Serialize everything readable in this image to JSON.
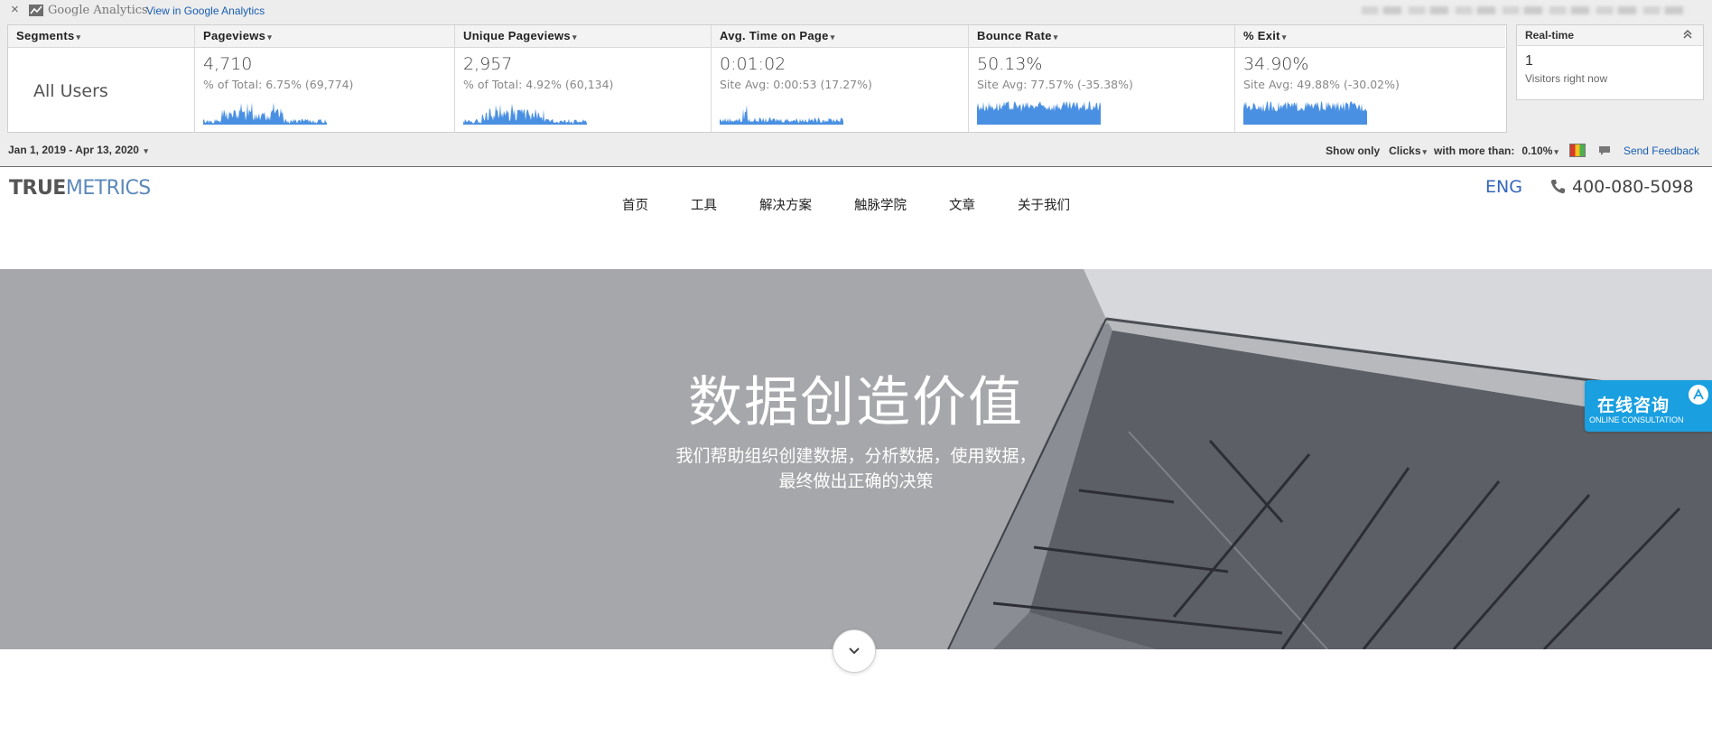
{
  "ga_bar": {
    "close_glyph": "×",
    "logo_text": "Google Analytics",
    "view_link": "View in Google Analytics"
  },
  "metrics": {
    "segments": {
      "header": "Segments",
      "value": "All Users"
    },
    "columns": [
      {
        "header": "Pageviews",
        "value": "4,710",
        "sub": "% of Total: 6.75% (69,774)",
        "spark": "spiky"
      },
      {
        "header": "Unique Pageviews",
        "value": "2,957",
        "sub": "% of Total: 4.92% (60,134)",
        "spark": "spiky"
      },
      {
        "header": "Avg. Time on Page",
        "value": "0:01:02",
        "sub": "Site Avg: 0:00:53 (17.27%)",
        "spark": "spiky-low"
      },
      {
        "header": "Bounce Rate",
        "value": "50.13%",
        "sub": "Site Avg: 77.57% (-35.38%)",
        "spark": "dense"
      },
      {
        "header": "% Exit",
        "value": "34.90%",
        "sub": "Site Avg: 49.88% (-30.02%)",
        "spark": "dense"
      }
    ]
  },
  "realtime": {
    "title": "Real-time",
    "value": "1",
    "label": "Visitors right now"
  },
  "filter_bar": {
    "date_range": "Jan 1, 2019 - Apr 13, 2020",
    "show_only": "Show only",
    "clicks": "Clicks",
    "with_more_than": "with more than:",
    "threshold": "0.10%",
    "send_feedback": "Send Feedback"
  },
  "site": {
    "logo_true": "TRUE",
    "logo_metrics": "METRICS",
    "nav": [
      "首页",
      "工具",
      "解决方案",
      "触脉学院",
      "文章",
      "关于我们"
    ],
    "lang": "ENG",
    "phone": "400-080-5098"
  },
  "hero": {
    "title": "数据创造价值",
    "subtitle_line1": "我们帮助组织创建数据，分析数据，使用数据，",
    "subtitle_line2": "最终做出正确的决策"
  },
  "consult": {
    "label_cn": "在线咨询",
    "label_en": "ONLINE CONSULTATION"
  },
  "colors": {
    "spark": "#4a90e2",
    "link": "#1a5eb2",
    "consult_bg": "#1a9fe0",
    "hero_bg": "#a6a7aa"
  },
  "icons": [
    "close-icon",
    "analytics-logo-icon",
    "collapse-icon",
    "heatmap-icon",
    "comment-icon",
    "phone-icon",
    "chevron-down-icon",
    "chat-badge-icon"
  ]
}
